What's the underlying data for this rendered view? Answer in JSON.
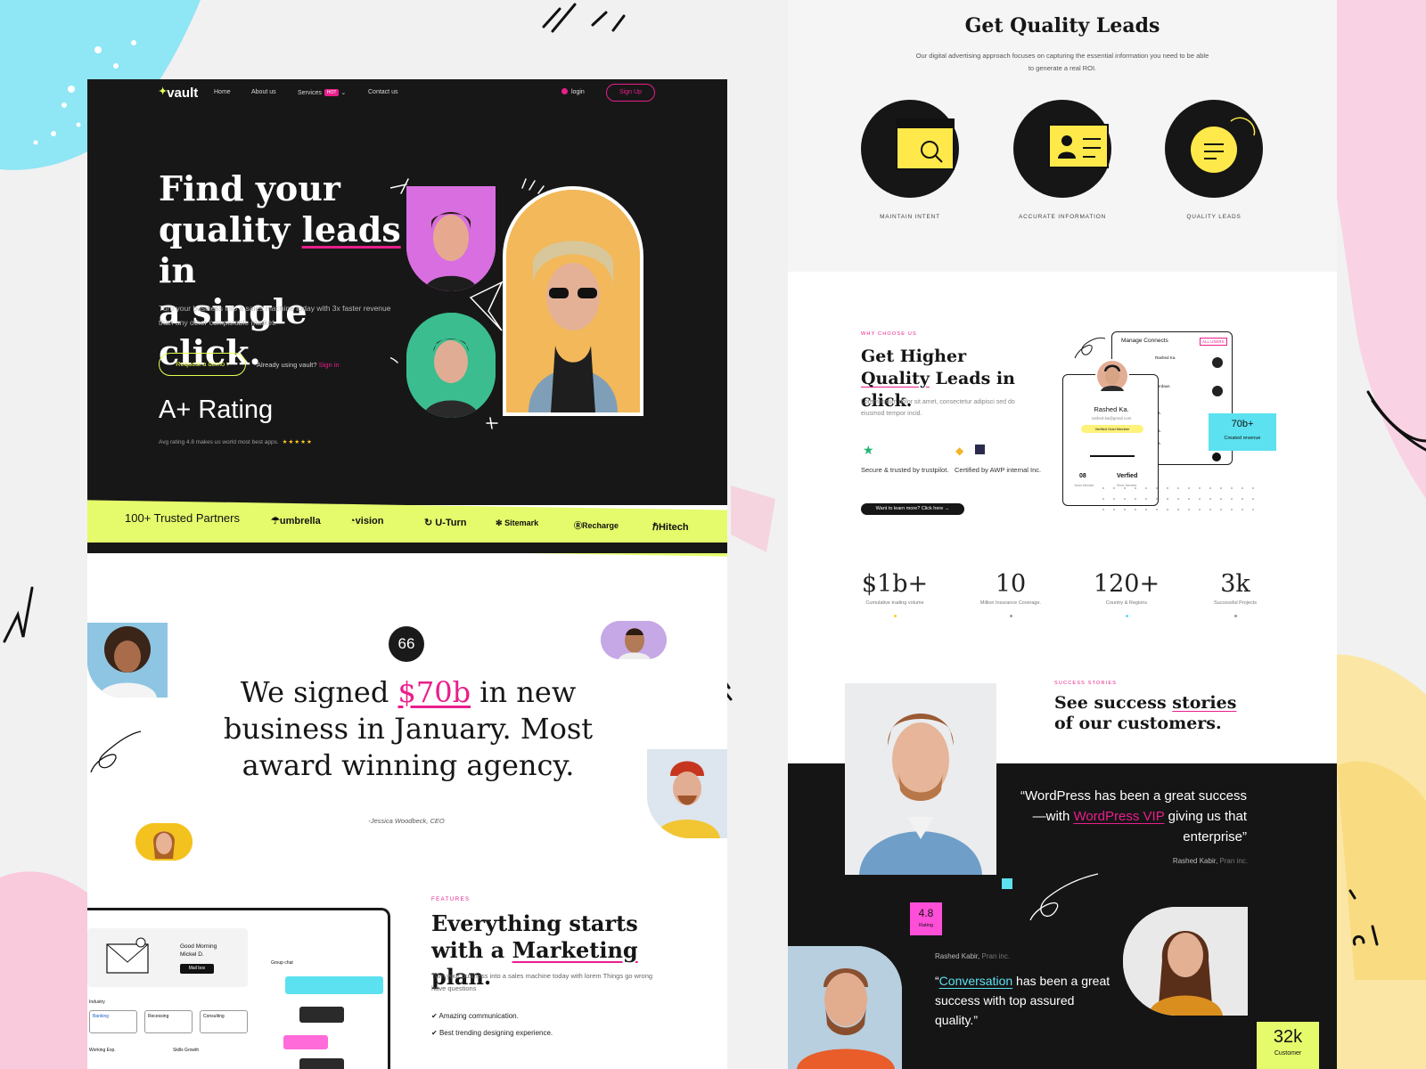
{
  "colors": {
    "accent_pink": "#e91e8c",
    "accent_lime": "#e5fb6b",
    "accent_cyan": "#5ce1f0",
    "dark": "#171717",
    "icon_yellow": "#ffe94a"
  },
  "left": {
    "nav": {
      "logo": "vault",
      "links": [
        "Home",
        "About us",
        "Services",
        "Contact us"
      ],
      "hot_badge": "HOT",
      "login": "login",
      "signup": "Sign Up"
    },
    "hero": {
      "title_line1": "Find your",
      "title_line2a": "quality ",
      "title_line2_hl": "leads",
      "title_line2b": " in",
      "title_line3": "a single click.",
      "subtitle": "Turn your business into a sales machine today with 3x faster revenue than any other comparable market.",
      "demo_button": "Request a demo",
      "already_text": "Already using vault?",
      "signin": "Sign in",
      "rating_title": "A+ Rating",
      "rating_sub": "Avg rating 4.8 makes us world most best apps.",
      "stars": "★★★★★"
    },
    "partners": {
      "label": "100+ Trusted Partners",
      "items": [
        "umbrella",
        "vision",
        "U-Turn",
        "Sitemark",
        "Recharge",
        "Hitech"
      ]
    },
    "quote": {
      "badge": "66",
      "pre": "We signed ",
      "highlight": "$70b",
      "post": " in new business in January. Most award winning agency.",
      "author": "-Jessica Woodbeck, CEO"
    },
    "features": {
      "kicker": "FEATURES",
      "title_pre": "Everything starts with a ",
      "title_ul": "Marketing",
      "title_post": " plan.",
      "desc": "Turn your business into a sales machine today with lorem Things go wrong have questions",
      "items": [
        "Amazing communication.",
        "Best trending designing experience."
      ]
    },
    "mock": {
      "greeting": "Good Morning Mickel D.",
      "mailbox": "Mail box",
      "group_chat": "Group chat",
      "industry": "Industry",
      "tags": [
        "Banking",
        "Recessing",
        "Consulting"
      ],
      "working_exp": "Working Exp.",
      "skills_growth": "Skills Growth"
    }
  },
  "right": {
    "quality": {
      "title": "Get Quality Leads",
      "subtitle": "Our digital advertising approach focuses on capturing the essential information you need to be able to generate a real ROI.",
      "items": [
        {
          "label": "MAINTAIN INTENT",
          "icon": "browser-search-icon"
        },
        {
          "label": "ACCURATE INFORMATION",
          "icon": "id-card-icon"
        },
        {
          "label": "QUALITY LEADS",
          "icon": "chat-bubble-icon"
        }
      ]
    },
    "why": {
      "kicker": "WHY CHOOSE US",
      "title_pre": "Get Higher ",
      "title_ul": "Quality",
      "title_post": " Leads in click.",
      "desc": "Lorem ipsum dolor sit amet, consectetur adipisci sed do eiusmod tempor incid.",
      "trust1": "Secure & trusted by trustpilot.",
      "trust2": "Certified by AWP internal Inc.",
      "learn_more": "Want to learn more? Click here →",
      "card": {
        "header": "Manage Connects",
        "all_users": "ALL USERS",
        "name": "Rashed Ka.",
        "email": "rashed.ka@gmail.com",
        "verified": "Verified Gold Member",
        "year_num": "08",
        "year_lbl": "Years Member",
        "verfied_num": "Verfied",
        "verfied_lbl": "Silver Member",
        "contacts": [
          "Rashed Ka.",
          "Ferdaus",
          "Ka.",
          "Ka.",
          "Ka."
        ],
        "stat_num": "70b+",
        "stat_lbl": "Created revenue"
      }
    },
    "stats": [
      {
        "num": "$1b+",
        "label": "Cumulative trading volume",
        "dot": "#ffc928"
      },
      {
        "num": "10",
        "label": "Million Insurance Coverage.",
        "dot": "#999999"
      },
      {
        "num": "120+",
        "label": "Country & Regions",
        "dot": "#5ce1f0"
      },
      {
        "num": "3k",
        "label": "Successful Projects",
        "dot": "#999999"
      }
    ],
    "success": {
      "kicker": "SUCCESS STORIES",
      "title_pre": "See success ",
      "title_ul": "stories",
      "title_post": " of our customers."
    },
    "testimonial1": {
      "pre": "“WordPress has been a great success—with ",
      "link": "WordPress VIP",
      "post": " giving us that enterprise”",
      "author": "Rashed Kabir,",
      "company": "Pran inc."
    },
    "testimonial2": {
      "author": "Rashed Kabir,",
      "company": "Pran inc.",
      "open": "“",
      "link": "Conversation",
      "post": " has been a great success with top assured quality.”"
    },
    "rating_box": {
      "num": "4.8",
      "label": "Rating"
    },
    "customers_box": {
      "num": "32k",
      "label": "Customer"
    }
  }
}
